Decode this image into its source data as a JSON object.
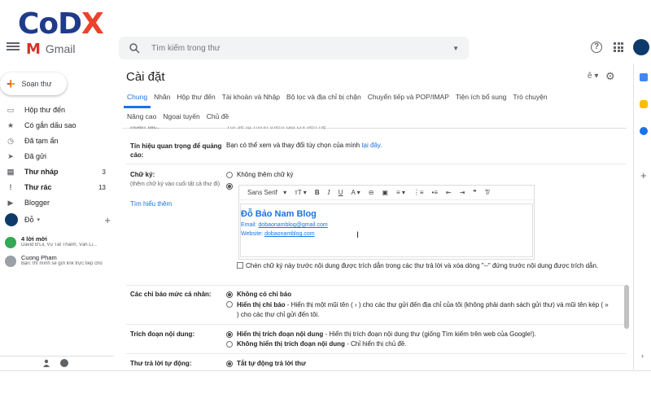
{
  "watermark": {
    "text": "CoDX"
  },
  "header": {
    "app_name": "Gmail",
    "search_placeholder": "Tìm kiếm trong thư"
  },
  "nav": {
    "compose_label": "Soạn thư",
    "items": [
      {
        "label": "Hộp thư đến",
        "count": "",
        "icon": "inbox-icon",
        "bold": false
      },
      {
        "label": "Có gắn dấu sao",
        "count": "",
        "icon": "star-icon",
        "bold": false
      },
      {
        "label": "Đã tạm ẩn",
        "count": "",
        "icon": "clock-icon",
        "bold": false
      },
      {
        "label": "Đã gửi",
        "count": "",
        "icon": "send-icon",
        "bold": false
      },
      {
        "label": "Thư nháp",
        "count": "3",
        "icon": "draft-icon",
        "bold": true
      },
      {
        "label": "Thư rác",
        "count": "13",
        "icon": "spam-icon",
        "bold": true
      },
      {
        "label": "Blogger",
        "count": "",
        "icon": "label-icon",
        "bold": false
      }
    ],
    "hangouts_user": "Đỗ",
    "chats": [
      {
        "title": "4 lời mời",
        "subtitle": "David B'Lii, Vũ Tất Thành, Văn Li...",
        "color": "#34a853"
      },
      {
        "title": "Cuong Pham",
        "subtitle": "Bạn: thì mình sẽ gửi link trực tiếp cho",
        "color": "#9aa0a6"
      }
    ]
  },
  "settings": {
    "title": "Cài đặt",
    "tabs_row1": [
      "Chung",
      "Nhãn",
      "Hộp thư đến",
      "Tài khoản và Nhập",
      "Bộ lọc và địa chỉ bị chặn",
      "Chuyển tiếp và POP/IMAP",
      "Tiện ích bổ sung",
      "Trò chuyện"
    ],
    "tabs_row2": [
      "Nâng cao",
      "Ngoại tuyến",
      "Chủ đề"
    ],
    "partial_top": {
      "label": "hoàn tác:",
      "text": "Tôi sẽ tự mình thêm địa chỉ liên hệ"
    },
    "important_signals": {
      "label": "Tín hiệu quan trọng để quảng cáo:",
      "text": "Bạn có thể xem và thay đổi tùy chọn của mình",
      "link": "tại đây."
    },
    "signature": {
      "label": "Chữ ký:",
      "hint": "(thêm chữ ký vào cuối tất cả thư đi)",
      "learn_more": "Tìm hiểu thêm",
      "no_signature": "Không thêm chữ ký",
      "font": "Sans Serif",
      "name": "Đỗ Bảo Nam Blog",
      "email_label": "Email:",
      "email": "dobaonamblog@gmail.com",
      "website_label": "Website:",
      "website": "dobaonamblog.com",
      "insert_before": "Chèn chữ ký này trước nội dung được trích dẫn trong các thư trả lời và xóa dòng \"--\" đứng trước nội dung được trích dẫn."
    },
    "personal_level": {
      "label": "Các chỉ báo mức cá nhân:",
      "opt1": "Không có chỉ báo",
      "opt2_title": "Hiển thị chỉ báo",
      "opt2_text": "- Hiển thị một mũi tên ( › ) cho các thư gửi đến địa chỉ của tôi (không phải danh sách gửi thư) và mũi tên kép ( » ) cho các thư chỉ gửi đến tôi."
    },
    "snippets": {
      "label": "Trích đoạn nội dung:",
      "opt1_title": "Hiển thị trích đoạn nội dung",
      "opt1_text": "- Hiển thị trích đoạn nội dung thư (giống Tìm kiếm trên web của Google!).",
      "opt2_title": "Không hiển thị trích đoạn nội dung",
      "opt2_text": "- Chỉ hiển thị chủ đề."
    },
    "auto_reply": {
      "label": "Thư trả lời tự động:",
      "opt1": "Tắt tự động trả lời thư"
    }
  }
}
